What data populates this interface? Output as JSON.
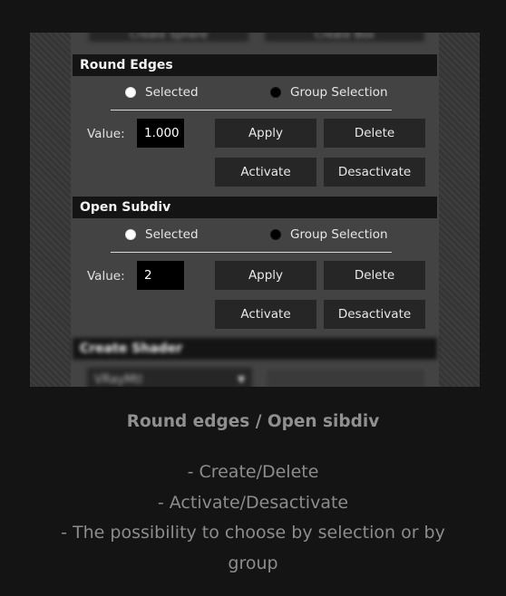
{
  "round_edges": {
    "title": "Round Edges",
    "radio_selected": "Selected",
    "radio_group": "Group Selection",
    "value_label": "Value:",
    "value": "1.000",
    "apply": "Apply",
    "delete": "Delete",
    "activate": "Activate",
    "desactivate": "Desactivate"
  },
  "open_subdiv": {
    "title": "Open Subdiv",
    "radio_selected": "Selected",
    "radio_group": "Group Selection",
    "value_label": "Value:",
    "value": "2",
    "apply": "Apply",
    "delete": "Delete",
    "activate": "Activate",
    "desactivate": "Desactivate"
  },
  "blurred": {
    "top_button_left": "Create Sphere",
    "top_button_right": "Create Box",
    "create_shader_title": "Create Shader",
    "shader_dropdown": "VRayMtl"
  },
  "caption": {
    "title": "Round edges / Open sibdiv",
    "line1": "- Create/Delete",
    "line2": "- Activate/Desactivate",
    "line3": "- The possibility to choose by selection or by",
    "line4": "group"
  },
  "colors": {
    "page_bg": "#141414",
    "panel_bg": "#434343",
    "header_bg": "#141414",
    "button_bg": "#262626",
    "caption_text": "#8c8c8c"
  }
}
